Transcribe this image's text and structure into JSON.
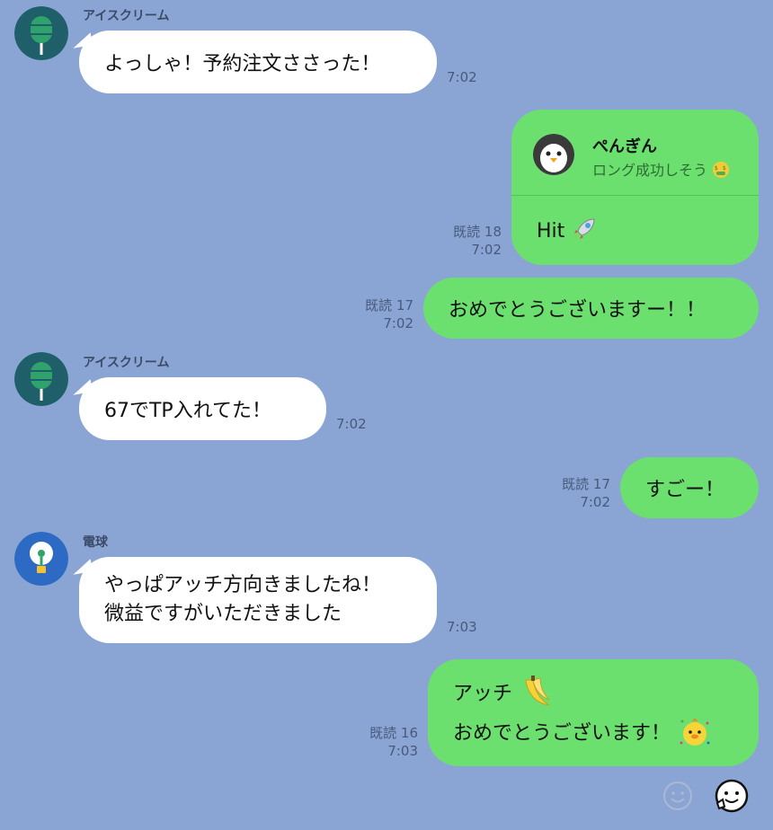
{
  "colors": {
    "background": "#8aa5d4",
    "incoming_bubble": "#ffffff",
    "outgoing_bubble": "#6ce06e",
    "meta_text": "#475a7c"
  },
  "messages": [
    {
      "sender": "アイスクリーム",
      "text": "よっしゃ！予約注文ささった！",
      "time": "7:02"
    },
    {
      "reply_card": {
        "name": "ぺんぎん",
        "quote": "ロング成功しそう",
        "quote_emoji": "money-mouth-face"
      },
      "text": "Hit",
      "text_emoji": "rocket",
      "read": "既読 18",
      "time": "7:02"
    },
    {
      "text": "おめでとうございますー！！",
      "read": "既読 17",
      "time": "7:02"
    },
    {
      "sender": "アイスクリーム",
      "text": "67でTP入れてた！",
      "time": "7:02"
    },
    {
      "text": "すごー！",
      "read": "既読 17",
      "time": "7:02"
    },
    {
      "sender": "電球",
      "line1": "やっぱアッチ方向きましたね！",
      "line2": "微益ですがいただきました",
      "time": "7:03"
    },
    {
      "line1": "アッチ",
      "line1_emoji": "banana",
      "line2": "おめでとうございます！",
      "line2_emoji": "chick-sticker-emoji",
      "read": "既読 16",
      "time": "7:03"
    }
  ],
  "footer": {
    "emoji_button_icon": "smiley-face-icon",
    "sticker_button_icon": "thumbs-up-sticker-icon"
  }
}
